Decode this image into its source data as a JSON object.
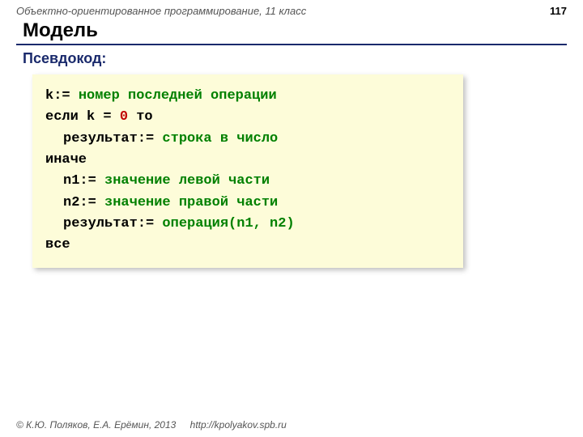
{
  "header": {
    "course": "Объектно-ориентированное программирование, 11 класс",
    "page": "117"
  },
  "title": "Модель",
  "subtitle": "Псевдокод:",
  "code": {
    "l1a": "k:=",
    "l1b": "номер последней операции",
    "l2a": "если k = ",
    "l2b": "0",
    "l2c": " то",
    "l3a": "результат:=",
    "l3b": "строка в число",
    "l4": "иначе",
    "l5a": "n1:=",
    "l5b": "значение левой части",
    "l6a": "n2:=",
    "l6b": "значение правой части",
    "l7a": "результат:=",
    "l7b": "операция(n1, n2)",
    "l8": "все"
  },
  "footer": {
    "copyright": "© К.Ю. Поляков, Е.А. Ерёмин, 2013",
    "url": "http://kpolyakov.spb.ru"
  }
}
